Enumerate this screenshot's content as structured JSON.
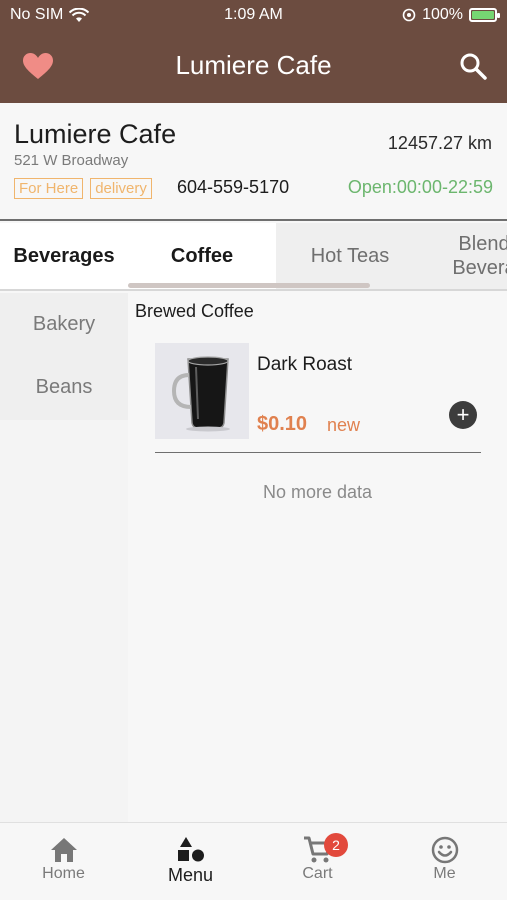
{
  "status_bar": {
    "carrier": "No SIM",
    "time": "1:09 AM",
    "battery": "100%"
  },
  "header": {
    "title": "Lumiere Cafe"
  },
  "cafe": {
    "name": "Lumiere Cafe",
    "address": "521 W Broadway",
    "distance": "12457.27 km",
    "tags": [
      "For Here",
      "delivery"
    ],
    "phone": "604-559-5170",
    "hours": "Open:00:00-22:59"
  },
  "tabs": [
    {
      "label": "Beverages"
    },
    {
      "label": "Coffee"
    },
    {
      "label": "Hot Teas"
    },
    {
      "label_line1": "Blend",
      "label_line2": "Bevera"
    }
  ],
  "subcategories": [
    {
      "label": "Bakery"
    },
    {
      "label": "Beans"
    }
  ],
  "section": {
    "title": "Brewed Coffee"
  },
  "products": [
    {
      "name": "Dark Roast",
      "price": "$0.10",
      "badge": "new",
      "add_icon": "plus-circle-icon"
    }
  ],
  "list_footer": "No more data",
  "bottom_nav": [
    {
      "label": "Home",
      "icon": "home-icon"
    },
    {
      "label": "Menu",
      "icon": "shapes-icon"
    },
    {
      "label": "Cart",
      "icon": "cart-icon",
      "badge": "2"
    },
    {
      "label": "Me",
      "icon": "smile-icon"
    }
  ],
  "colors": {
    "header": "#6c4c40",
    "price": "#e0814f",
    "open": "#6cb66e",
    "tag": "#f0b56d",
    "badge": "#e2493c"
  }
}
